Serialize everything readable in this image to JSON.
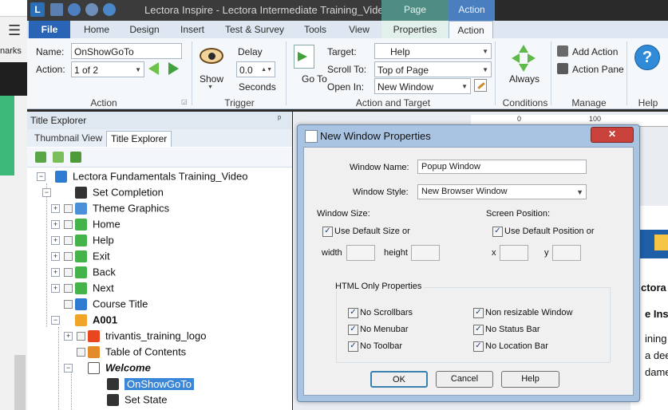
{
  "browser_strip": {
    "menu_glyph": "☰",
    "bookmarks_text": "narks"
  },
  "titlebar": {
    "app_icon": "L",
    "title": "Lectora Inspire - Lectora Intermediate Training_Video...",
    "context_page": "Page",
    "context_action": "Action",
    "quick_access_icons": [
      "save-icon",
      "undo-icon",
      "redo-icon",
      "customize-icon"
    ]
  },
  "ribbon_tabs": [
    "File",
    "Home",
    "Design",
    "Insert",
    "Test & Survey",
    "Tools",
    "View",
    "Properties",
    "Action"
  ],
  "ribbon": {
    "action_group": {
      "name_label": "Name:",
      "name_value": "OnShowGoTo",
      "action_label": "Action:",
      "action_value": "1 of 2",
      "group_label": "Action"
    },
    "trigger_group": {
      "show_label": "Show",
      "delay_label": "Delay",
      "delay_value": "0.0",
      "seconds_label": "Seconds",
      "group_label": "Trigger"
    },
    "target_group": {
      "go_to_label": "Go To",
      "target_label": "Target:",
      "target_value": "Help",
      "scroll_label": "Scroll To:",
      "scroll_value": "Top of Page",
      "open_label": "Open In:",
      "open_value": "New Window",
      "group_label": "Action and Target"
    },
    "conditions_group": {
      "always_label": "Always",
      "group_label": "Conditions"
    },
    "manage_group": {
      "add_action": "Add Action",
      "action_pane": "Action Pane",
      "group_label": "Manage"
    },
    "help_group": {
      "group_label": "Help",
      "help_glyph": "?"
    }
  },
  "explorer": {
    "title": "Title Explorer",
    "pin_glyph": "ᵖ",
    "tabs": [
      "Thumbnail View",
      "Title Explorer"
    ],
    "tree": [
      {
        "label": "Lectora Fundamentals Training_Video",
        "icon": "title-icon"
      },
      {
        "label": "Set Completion",
        "icon": "action-icon"
      },
      {
        "label": "Theme Graphics",
        "icon": "group-icon"
      },
      {
        "label": "Home",
        "icon": "button-icon"
      },
      {
        "label": "Help",
        "icon": "button-icon"
      },
      {
        "label": "Exit",
        "icon": "button-icon"
      },
      {
        "label": "Back",
        "icon": "button-icon"
      },
      {
        "label": "Next",
        "icon": "button-icon"
      },
      {
        "label": "Course Title",
        "icon": "text-icon"
      },
      {
        "label": "A001",
        "icon": "chapter-icon"
      },
      {
        "label": "trivantis_training_logo",
        "icon": "image-icon"
      },
      {
        "label": "Table of Contents",
        "icon": "toc-icon"
      },
      {
        "label": "Welcome",
        "icon": "page-icon"
      },
      {
        "label": "OnShowGoTo",
        "icon": "action-icon"
      },
      {
        "label": "Set State",
        "icon": "action-icon"
      }
    ]
  },
  "canvas": {
    "ruler_0": "0",
    "ruler_100": "100",
    "text1": "ctora v",
    "text2": "e Inst",
    "text3": "ining",
    "text4": "a dee",
    "text5": "damer"
  },
  "dialog": {
    "title": "New Window Properties",
    "close_glyph": "✕",
    "window_name_label": "Window Name:",
    "window_name_value": "Popup Window",
    "window_style_label": "Window Style:",
    "window_style_value": "New Browser Window",
    "window_size_label": "Window Size:",
    "use_default_size": "Use Default Size or",
    "width_label": "width",
    "height_label": "height",
    "screen_position_label": "Screen Position:",
    "use_default_position": "Use Default Position or",
    "x_label": "x",
    "y_label": "y",
    "html_group_label": "HTML Only Properties",
    "options": [
      "No Scrollbars",
      "Non resizable Window",
      "No Menubar",
      "No Status Bar",
      "No Toolbar",
      "No Location Bar"
    ],
    "ok_label": "OK",
    "cancel_label": "Cancel",
    "help_label": "Help"
  }
}
